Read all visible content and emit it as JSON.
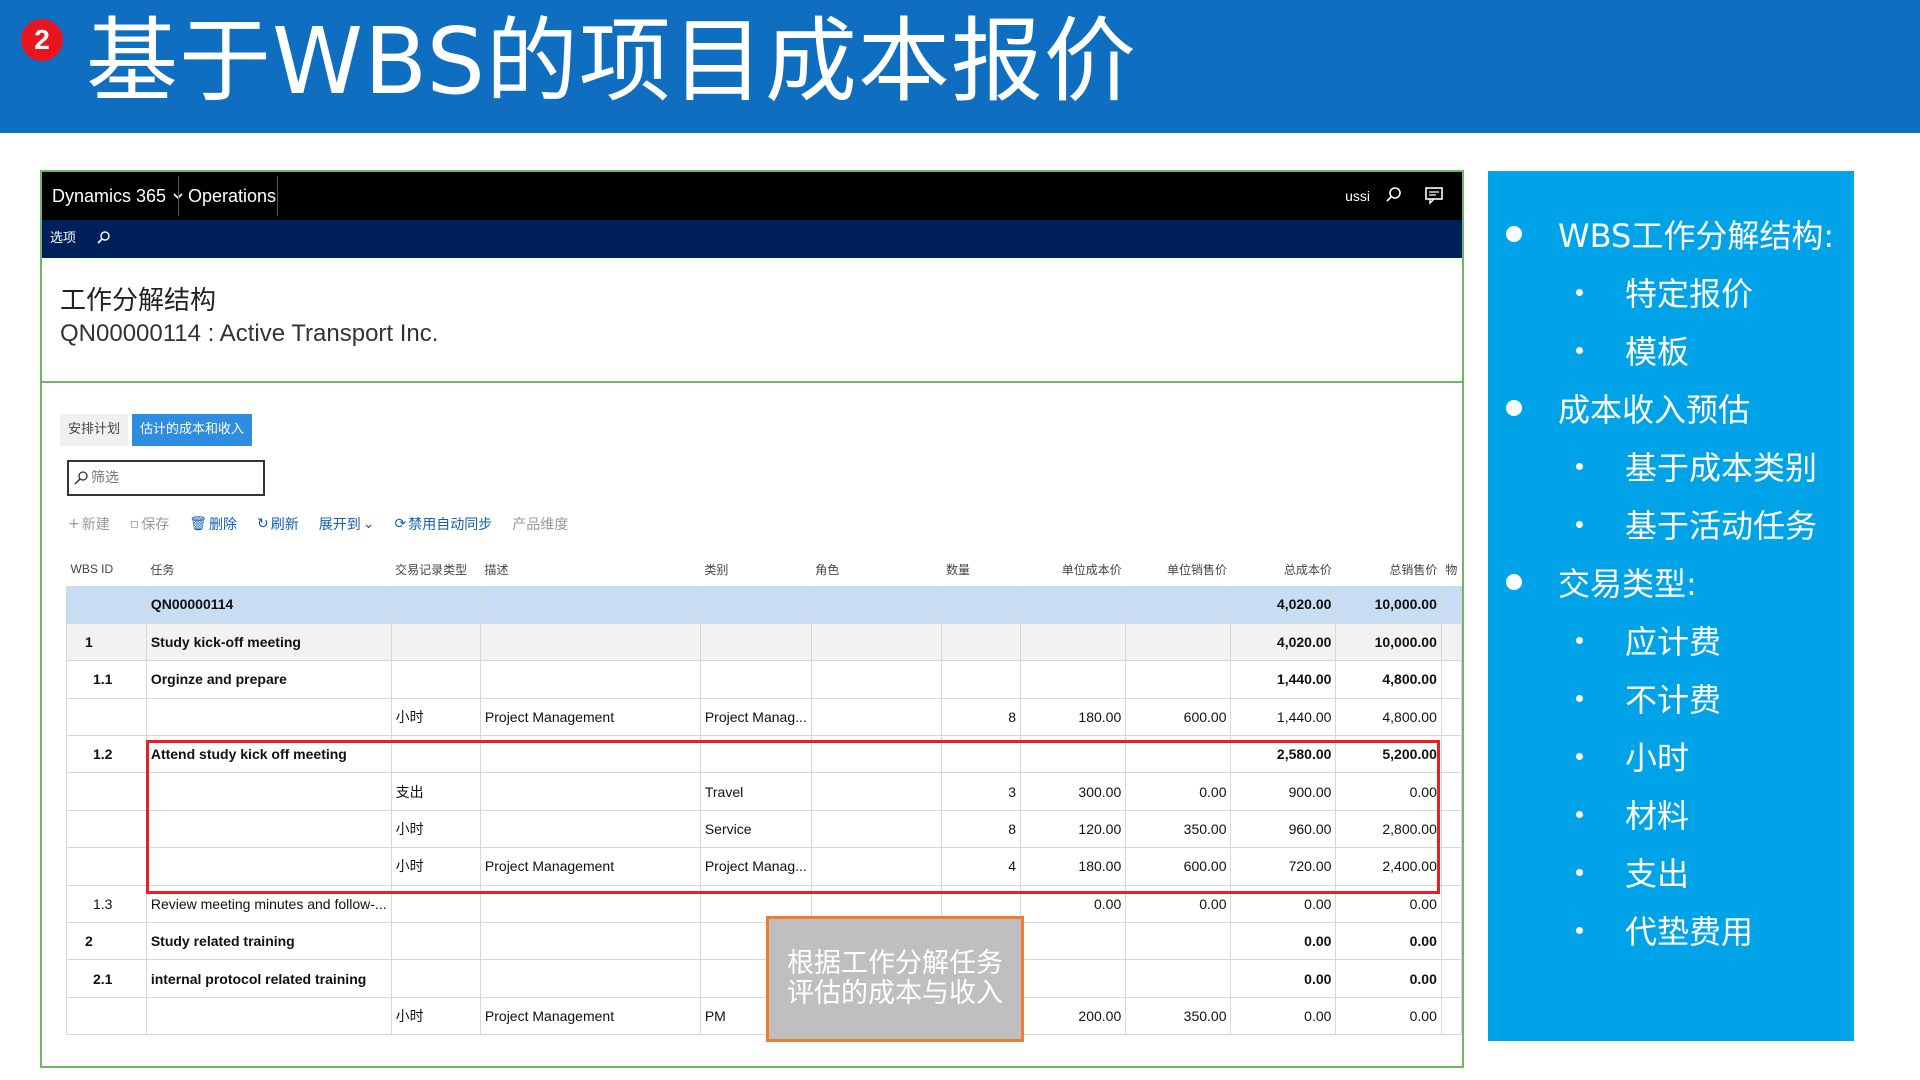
{
  "slide": {
    "badge": "2",
    "title": "基于WBS的项目成本报价"
  },
  "app": {
    "brand": "Dynamics 365",
    "module": "Operations",
    "company": "ussi",
    "options_label": "选项",
    "page_title": "工作分解结构",
    "page_subtitle": "QN00000114 : Active Transport Inc.",
    "tabs": [
      {
        "label": "安排计划",
        "active": false
      },
      {
        "label": "估计的成本和收入",
        "active": true
      }
    ],
    "filter_placeholder": "筛选",
    "toolbar": [
      {
        "label": "新建",
        "icon": "+",
        "state": "disabled"
      },
      {
        "label": "保存",
        "icon": "▫",
        "state": "disabled"
      },
      {
        "label": "删除",
        "icon": "🗑",
        "state": "enabled"
      },
      {
        "label": "刷新",
        "icon": "↻",
        "state": "enabled"
      },
      {
        "label": "展开到",
        "icon": "⌄",
        "state": "enabled"
      },
      {
        "label": "禁用自动同步",
        "icon": "⟳",
        "state": "enabled"
      },
      {
        "label": "产品维度",
        "icon": "",
        "state": "disabled"
      }
    ],
    "columns": [
      "WBS ID",
      "任务",
      "交易记录类型",
      "描述",
      "类别",
      "角色",
      "数量",
      "单位成本价",
      "单位销售价",
      "总成本价",
      "总销售价",
      "物"
    ],
    "rows": [
      {
        "style": "selected bold",
        "cells": [
          "",
          "QN00000114",
          "",
          "",
          "",
          "",
          "",
          "",
          "",
          "4,020.00",
          "10,000.00"
        ]
      },
      {
        "style": "summary bold",
        "cells": [
          "1",
          "Study kick-off meeting",
          "",
          "",
          "",
          "",
          "",
          "",
          "",
          "4,020.00",
          "10,000.00"
        ]
      },
      {
        "style": "bold sub",
        "cells": [
          "1.1",
          "Orginze and prepare",
          "",
          "",
          "",
          "",
          "",
          "",
          "",
          "1,440.00",
          "4,800.00"
        ]
      },
      {
        "style": "",
        "cells": [
          "",
          "",
          "小时",
          "Project Management",
          "Project Manag...",
          "",
          "8",
          "180.00",
          "600.00",
          "1,440.00",
          "4,800.00"
        ]
      },
      {
        "style": "bold sub",
        "cells": [
          "1.2",
          "Attend study kick off meeting",
          "",
          "",
          "",
          "",
          "",
          "",
          "",
          "2,580.00",
          "5,200.00"
        ]
      },
      {
        "style": "",
        "cells": [
          "",
          "",
          "支出",
          "",
          "Travel",
          "",
          "3",
          "300.00",
          "0.00",
          "900.00",
          "0.00"
        ]
      },
      {
        "style": "",
        "cells": [
          "",
          "",
          "小时",
          "",
          "Service",
          "",
          "8",
          "120.00",
          "350.00",
          "960.00",
          "2,800.00"
        ]
      },
      {
        "style": "",
        "cells": [
          "",
          "",
          "小时",
          "Project Management",
          "Project Manag...",
          "",
          "4",
          "180.00",
          "600.00",
          "720.00",
          "2,400.00"
        ]
      },
      {
        "style": "sub",
        "cells": [
          "1.3",
          "Review meeting minutes and follow-...",
          "",
          "",
          "",
          "",
          "",
          "0.00",
          "0.00",
          "0.00",
          "0.00"
        ]
      },
      {
        "style": "bold",
        "cells": [
          "2",
          "Study related training",
          "",
          "",
          "",
          "",
          "",
          "",
          "",
          "0.00",
          "0.00"
        ]
      },
      {
        "style": "bold sub",
        "cells": [
          "2.1",
          "internal protocol related training",
          "",
          "",
          "",
          "",
          "",
          "",
          "",
          "0.00",
          "0.00"
        ]
      },
      {
        "style": "",
        "cells": [
          "",
          "",
          "小时",
          "Project Management",
          "PM",
          "",
          "",
          "200.00",
          "350.00",
          "0.00",
          "0.00"
        ]
      }
    ]
  },
  "callout": "根据工作分解任务评估的成本与收入",
  "info_panel": [
    {
      "level": 1,
      "text": "WBS工作分解结构:"
    },
    {
      "level": 2,
      "text": "特定报价"
    },
    {
      "level": 2,
      "text": "模板"
    },
    {
      "level": 1,
      "text": "成本收入预估"
    },
    {
      "level": 2,
      "text": "基于成本类别"
    },
    {
      "level": 2,
      "text": "基于活动任务"
    },
    {
      "level": 1,
      "text": "交易类型:"
    },
    {
      "level": 2,
      "text": "应计费"
    },
    {
      "level": 2,
      "text": "不计费"
    },
    {
      "level": 2,
      "text": "小时"
    },
    {
      "level": 2,
      "text": "材料"
    },
    {
      "level": 2,
      "text": "支出"
    },
    {
      "level": 2,
      "text": "代垫费用"
    }
  ]
}
